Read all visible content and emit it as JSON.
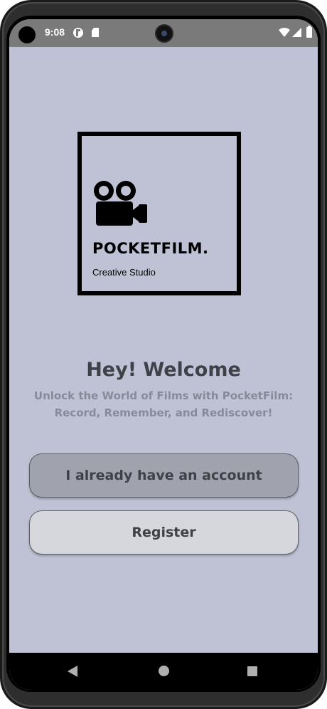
{
  "status_bar": {
    "time": "9:08",
    "icons": [
      "punch-hole",
      "f-notification-icon",
      "sd-card-icon",
      "wifi-icon",
      "signal-icon",
      "battery-icon"
    ]
  },
  "logo": {
    "icon": "movie-camera-icon",
    "name": "POCKETFILM.",
    "tagline": "Creative Studio"
  },
  "welcome": {
    "title": "Hey! Welcome",
    "subtitle_line1": "Unlock the World of Films with PocketFilm:",
    "subtitle_line2": "Record, Remember, and Rediscover!"
  },
  "buttons": {
    "login_label": "I already have an account",
    "register_label": "Register"
  },
  "nav_bar": {
    "icons": [
      "back-icon",
      "home-icon",
      "recents-icon"
    ]
  },
  "colors": {
    "background": "#bfc2d4",
    "status_bar": "#7a7a7a",
    "title_text": "#3f4148",
    "subtitle_text": "#878a98",
    "login_button": "#a0a3ae",
    "register_button": "#d6d7dc"
  }
}
